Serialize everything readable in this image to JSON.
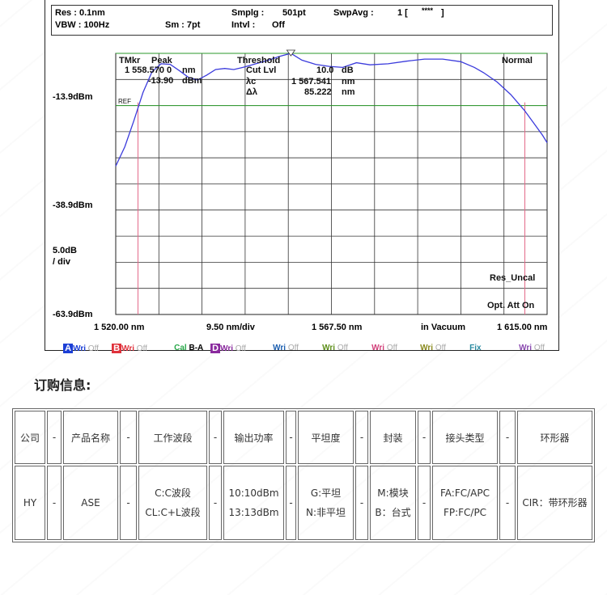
{
  "header": {
    "res": "Res : 0.1nm",
    "vbw": "VBW : 100Hz",
    "smplg_label": "Smplg :",
    "smplg_value": "501pt",
    "sm": "Sm : 7pt",
    "intvl_label": "Intvl :",
    "intvl_value": "Off",
    "swpavg_label": "SwpAvg :",
    "swpavg_value": "1 [",
    "swpavg_stars": "****",
    "swpavg_close": "]"
  },
  "markers": {
    "tmkr": "TMkr",
    "peak": "Peak",
    "wavelength": "1 558.570 0",
    "wavelength_unit": "nm",
    "level": "-13.90",
    "level_unit": "dBm",
    "threshold": "Threshold",
    "cut_lvl_label": "Cut Lvl",
    "cut_lvl_value": "10.0",
    "cut_lvl_unit": "dB",
    "lambda_c_label": "λc",
    "lambda_c_value": "1 567.541",
    "lambda_c_unit": "nm",
    "delta_lambda_label": "Δλ",
    "delta_lambda_value": "85.222",
    "delta_lambda_unit": "nm",
    "mode": "Normal",
    "ref": "REF",
    "res_uncal": "Res_Uncal",
    "opt_att": "Opt. Att On"
  },
  "chart_data": {
    "type": "line",
    "x_unit": "nm",
    "y_unit": "dBm",
    "xlim": [
      1520.0,
      1615.0
    ],
    "ylim": [
      -63.9,
      -13.9
    ],
    "y_tick_labels": [
      "-13.9dBm",
      "-38.9dBm",
      "-63.9dBm"
    ],
    "y_scale_label": "5.0dB\n/ div",
    "x_tick_labels": [
      "1 520.00 nm",
      "9.50 nm/div",
      "1 567.50 nm",
      "in Vacuum",
      "1 615.00 nm"
    ],
    "grid": true,
    "threshold_level": -23.9,
    "threshold_edges": [
      1524.9,
      1610.1
    ],
    "series": [
      {
        "color": "#3b3bdc",
        "x": [
          1520.0,
          1522.0,
          1524.0,
          1526.0,
          1528.0,
          1530.0,
          1532.0,
          1534.0,
          1536.0,
          1538.0,
          1540.0,
          1542.0,
          1544.0,
          1546.0,
          1548.0,
          1550.0,
          1552.0,
          1554.0,
          1556.0,
          1558.57,
          1561.0,
          1564.0,
          1567.0,
          1570.0,
          1573.0,
          1576.0,
          1580.0,
          1584.0,
          1588.0,
          1592.0,
          1596.0,
          1599.0,
          1601.0,
          1604.0,
          1607.0,
          1610.0,
          1612.0,
          1614.0,
          1615.0
        ],
        "y": [
          -35.5,
          -31.8,
          -26.8,
          -21.4,
          -17.4,
          -15.9,
          -16.0,
          -17.2,
          -18.5,
          -19.0,
          -18.1,
          -17.0,
          -16.8,
          -17.0,
          -16.6,
          -16.1,
          -15.6,
          -15.1,
          -14.5,
          -13.9,
          -15.2,
          -16.0,
          -16.4,
          -16.6,
          -15.7,
          -16.1,
          -15.9,
          -15.4,
          -15.0,
          -15.0,
          -15.5,
          -16.6,
          -17.6,
          -19.4,
          -21.8,
          -24.8,
          -27.2,
          -29.6,
          -31.0
        ]
      }
    ]
  },
  "traces": [
    {
      "letter": "A",
      "box_color": "#1c3fd6",
      "text_color": "#1c3fd6",
      "mode": "Wri",
      "state": "Off"
    },
    {
      "letter": "B",
      "box_color": "#e0323c",
      "text_color": "#e0323c",
      "mode": "Wri",
      "state": "Off"
    },
    {
      "letter": "Cal",
      "text_color": "#2aa84a",
      "mode": "B-A"
    },
    {
      "letter": "D",
      "box_color": "#8a2a9e",
      "text_color": "#8a2a9e",
      "mode": "Wri",
      "state": "Off"
    },
    {
      "text_color": "#1c5fb0",
      "mode": "Wri",
      "state": "Off"
    },
    {
      "text_color": "#5e8f1a",
      "mode": "Wri",
      "state": "Off"
    },
    {
      "text_color": "#d2407a",
      "mode": "Wri",
      "state": "Off"
    },
    {
      "text_color": "#8a8a1e",
      "mode": "Wri",
      "state": "Off"
    },
    {
      "text_color": "#2a8aa0",
      "mode": "Fix"
    },
    {
      "text_color": "#8a4ab0",
      "mode": "Wri",
      "state": "Off"
    }
  ],
  "ordering": {
    "title": "订购信息:",
    "dash": "-",
    "headers": [
      "公司",
      "产品名称",
      "工作波段",
      "输出功率",
      "平坦度",
      "封装",
      "接头类型",
      "环形器"
    ],
    "row": [
      [
        "HY"
      ],
      [
        "ASE"
      ],
      [
        "C:C波段",
        "CL:C+L波段"
      ],
      [
        "10:10dBm",
        "13:13dBm"
      ],
      [
        "G:平坦",
        "N:非平坦"
      ],
      [
        "M:模块",
        "B：台式"
      ],
      [
        "FA:FC/APC",
        "FP:FC/PC"
      ],
      [
        "CIR：带环形器"
      ]
    ]
  }
}
